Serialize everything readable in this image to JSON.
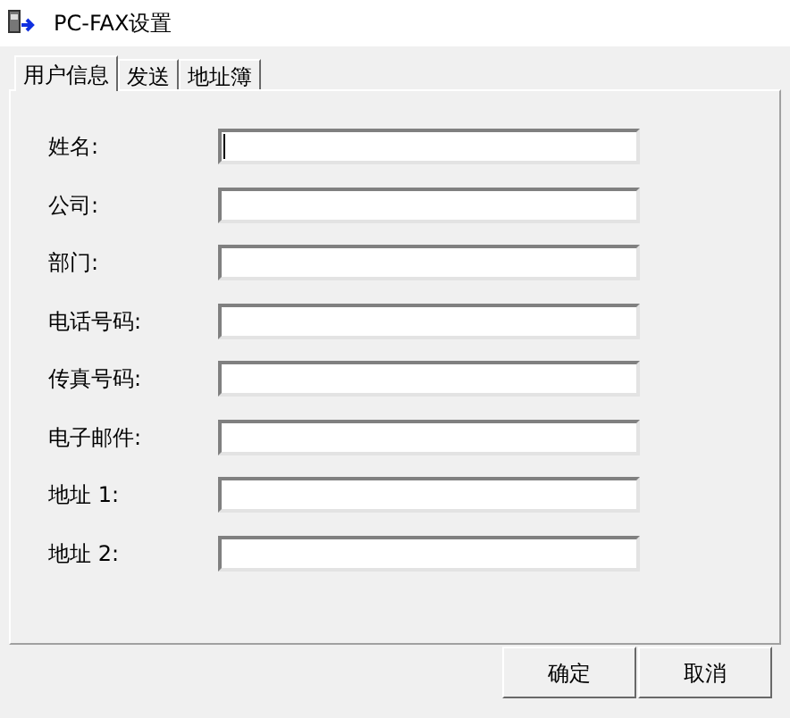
{
  "window": {
    "title": "PC-FAX设置"
  },
  "tabs": [
    {
      "label": "用户信息",
      "selected": true
    },
    {
      "label": "发送",
      "selected": false
    },
    {
      "label": "地址簿",
      "selected": false
    }
  ],
  "fields": [
    {
      "label": "姓名:",
      "focused": true
    },
    {
      "label": "公司:",
      "focused": false
    },
    {
      "label": "部门:",
      "focused": false
    },
    {
      "label": "电话号码:",
      "focused": false
    },
    {
      "label": "传真号码:",
      "focused": false
    },
    {
      "label": "电子邮件:",
      "focused": false
    },
    {
      "label": "地址 1:",
      "focused": false
    },
    {
      "label": "地址 2:",
      "focused": false
    }
  ],
  "buttons": [
    "确定",
    "取消"
  ]
}
